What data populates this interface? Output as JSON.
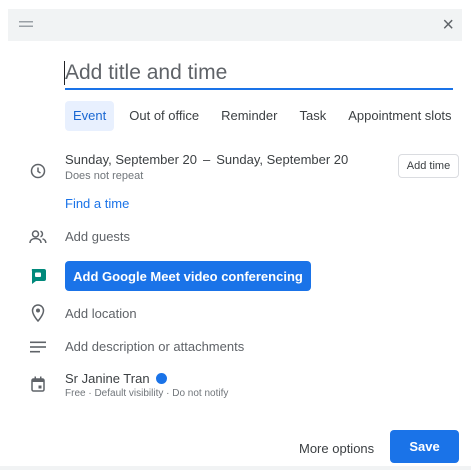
{
  "dialog": {
    "drag_handle_icon": "drag-handle-icon",
    "close_symbol": "×"
  },
  "title": {
    "placeholder": "Add title and time",
    "value": ""
  },
  "tabs": [
    {
      "label": "Event",
      "active": true
    },
    {
      "label": "Out of office",
      "active": false
    },
    {
      "label": "Reminder",
      "active": false
    },
    {
      "label": "Task",
      "active": false
    },
    {
      "label": "Appointment slots",
      "active": false
    }
  ],
  "datetime": {
    "start": "Sunday, September 20",
    "separator": "–",
    "end": "Sunday, September 20",
    "repeat": "Does not repeat",
    "add_time_label": "Add time"
  },
  "find_time": "Find a time",
  "guests": {
    "label": "Add guests"
  },
  "meet": {
    "label": "Add Google Meet video conferencing"
  },
  "location": {
    "label": "Add location"
  },
  "description": {
    "label": "Add description or attachments"
  },
  "owner": {
    "name": "Sr Janine Tran",
    "dot_color": "#1a73e8",
    "details": "Free · Default visibility · Do not notify"
  },
  "footer": {
    "more_options": "More options",
    "save": "Save"
  },
  "colors": {
    "accent": "#1a73e8",
    "meet_icon": "#00897b",
    "text": "#3c4043"
  }
}
